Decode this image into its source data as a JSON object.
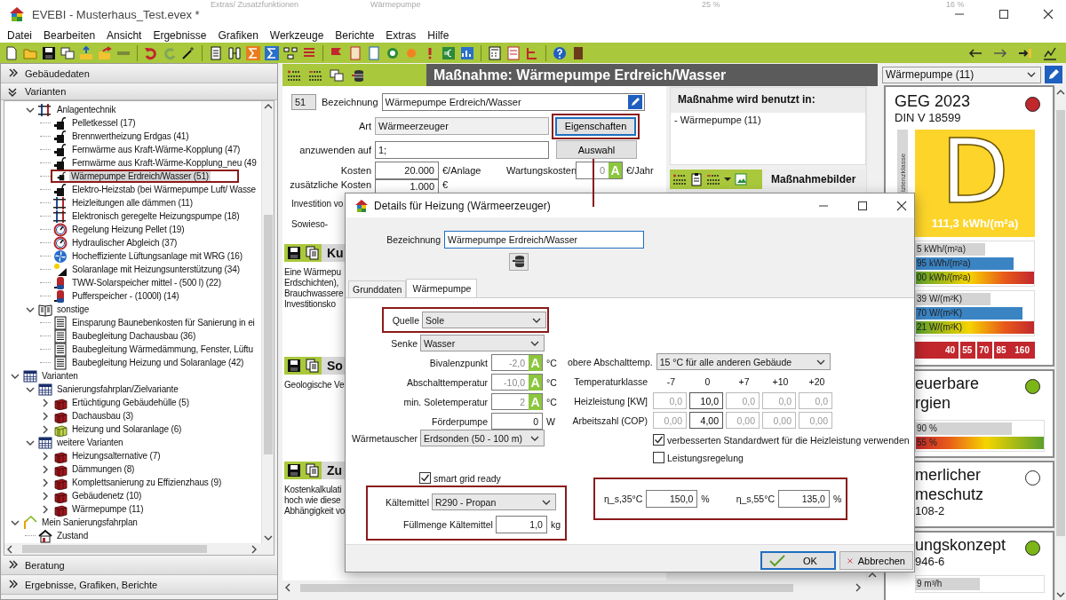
{
  "window": {
    "title": "EVEBI  - Musterhaus_Test.evex *",
    "background_texts": [
      "Extras/ Zusatzfunktionen",
      "Wärmepumpe",
      "25 %",
      "16 %"
    ]
  },
  "menu": [
    "Datei",
    "Bearbeiten",
    "Ansicht",
    "Ergebnisse",
    "Grafiken",
    "Werkzeuge",
    "Berichte",
    "Extras",
    "Hilfe"
  ],
  "left_panel": {
    "top_sections": [
      {
        "label": "Gebäudedaten",
        "expanded": false
      },
      {
        "label": "Varianten",
        "expanded": true
      }
    ],
    "tree": {
      "scrolled_group": [
        {
          "label": "Anlagentechnik",
          "kind": "pipes",
          "selected": false,
          "expanded": true,
          "children": [
            {
              "label": "Pelletkessel (17)",
              "kind": "heater",
              "selected": false
            },
            {
              "label": "Brennwertheizung Erdgas (41)",
              "kind": "heater",
              "selected": false
            },
            {
              "label": "Fernwärme aus Kraft-Wärme-Kopplung (47)",
              "kind": "heater",
              "selected": false
            },
            {
              "label": "Fernwärme aus Kraft-Wärme-Kopplung_neu (49",
              "kind": "heater",
              "selected": false
            },
            {
              "label": "Wärmepumpe Erdreich/Wasser (51)",
              "kind": "heater",
              "selected": true
            },
            {
              "label": "Elektro-Heizstab (bei Wärmepumpe Luft/ Wasse",
              "kind": "heater",
              "selected": false
            },
            {
              "label": "Heizleitungen alle dämmen (11)",
              "kind": "pipes",
              "selected": false
            },
            {
              "label": "Elektronisch geregelte Heizungspumpe (18)",
              "kind": "pipes",
              "selected": false
            },
            {
              "label": "Regelung Heizung Pellet (19)",
              "kind": "gauge",
              "selected": false
            },
            {
              "label": "Hydraulischer Abgleich (37)",
              "kind": "gauge",
              "selected": false
            },
            {
              "label": "Hocheffiziente Lüftungsanlage mit WRG (16)",
              "kind": "fan",
              "selected": false
            },
            {
              "label": "Solaranlage mit Heizungsunterstützung (34)",
              "kind": "solar",
              "selected": false
            },
            {
              "label": "TWW-Solarspeicher mittel - (500 l) (22)",
              "kind": "tank",
              "selected": false
            },
            {
              "label": "Pufferspeicher - (1000l) (14)",
              "kind": "tank",
              "selected": false
            }
          ]
        },
        {
          "label": "sonstige",
          "kind": "book",
          "selected": false,
          "expanded": true,
          "children": [
            {
              "label": "Einsparung Baunebenkosten für Sanierung in ei",
              "kind": "doc",
              "selected": false
            },
            {
              "label": "Baubegleitung Dachausbau (36)",
              "kind": "doc",
              "selected": false
            },
            {
              "label": "Baubegleitung Wärmedämmung, Fenster, Lüftu",
              "kind": "doc",
              "selected": false
            },
            {
              "label": "Baubegleitung Heizung und Solaranlage (42)",
              "kind": "doc",
              "selected": false
            }
          ]
        }
      ],
      "nodes": [
        {
          "label": "Varianten",
          "kind": "calendar",
          "selected": false,
          "expanded": true,
          "children": [
            {
              "label": "Sanierungsfahrplan/Zielvariante",
              "kind": "calendar",
              "selected": false,
              "expanded": true,
              "children": [
                {
                  "label": "Ertüchtigung Gebäudehülle (5)",
                  "kind": "gift",
                  "selected": false,
                  "expanded": false
                },
                {
                  "label": "Dachausbau (3)",
                  "kind": "gift",
                  "selected": false,
                  "expanded": false
                },
                {
                  "label": "Heizung und Solaranlage (6)",
                  "kind": "gift-green",
                  "selected": false,
                  "expanded": false
                }
              ]
            },
            {
              "label": "weitere Varianten",
              "kind": "calendar",
              "selected": false,
              "expanded": true,
              "children": [
                {
                  "label": "Heizungsalternative (7)",
                  "kind": "gift",
                  "selected": false,
                  "expanded": false
                },
                {
                  "label": "Dämmungen (8)",
                  "kind": "gift",
                  "selected": false,
                  "expanded": false
                },
                {
                  "label": "Komplettsanierung zu Effizienzhaus (9)",
                  "kind": "gift",
                  "selected": false,
                  "expanded": false
                },
                {
                  "label": "Gebäudenetz (10)",
                  "kind": "gift",
                  "selected": false,
                  "expanded": false
                },
                {
                  "label": "Wärmepumpe (11)",
                  "kind": "gift",
                  "selected": false,
                  "expanded": false
                }
              ]
            }
          ]
        },
        {
          "label": "Mein Sanierungsfahrplan",
          "kind": "plan",
          "selected": false,
          "expanded": true,
          "children": [
            {
              "label": "Zustand",
              "kind": "house",
              "selected": false
            }
          ]
        }
      ]
    },
    "bottom_sections": [
      {
        "label": "Beratung",
        "expanded": false
      },
      {
        "label": "Ergebnisse, Grafiken, Berichte",
        "expanded": false
      }
    ]
  },
  "measure": {
    "title": "Maßnahme: Wärmepumpe Erdreich/Wasser",
    "number": "51",
    "name": {
      "label": "Bezeichnung",
      "value": "Wärmepumpe Erdreich/Wasser"
    },
    "type": {
      "label": "Art",
      "value": "Wärmeerzeuger"
    },
    "properties_button": {
      "label": "Eigenschaften",
      "annotated": true
    },
    "apply_to": {
      "label": "anzuwenden auf",
      "value": "1;"
    },
    "select_button": {
      "label": "Auswahl"
    },
    "costs": {
      "label": "Kosten",
      "value": "20.000",
      "unit": "€/Anlage"
    },
    "maintenance": {
      "label": "Wartungskosten",
      "value": "0",
      "badge": "A",
      "unit": "€/Jahr"
    },
    "extra_costs": {
      "label": "zusätzliche Kosten",
      "value": "1.000",
      "unit": "€"
    },
    "cut_labels": [
      "Investition vo",
      "Sowieso-"
    ],
    "sections": [
      {
        "title": "Ku",
        "lines": [
          "Eine Wärmepu",
          "Erdschichten),",
          "Brauchwassere",
          "Investitionsko"
        ]
      },
      {
        "title": "So",
        "lines": [
          "Geologische Ve"
        ]
      },
      {
        "title": "Zu",
        "lines": [
          "Kostenkalkulati",
          "hoch wie diese",
          "Abhängigkeit vo"
        ]
      }
    ],
    "used_in": {
      "title": "Maßnahme wird benutzt in:",
      "items": [
        "- Wärmepumpe (11)"
      ]
    },
    "pictures_title": "Maßnahmebilder"
  },
  "dialog": {
    "title": "Details für Heizung  (Wärmeerzeuger)",
    "name": {
      "label": "Bezeichnung",
      "value": "Wärmepumpe Erdreich/Wasser"
    },
    "tabs": [
      {
        "label": "Grunddaten",
        "selected": false
      },
      {
        "label": "Wärmepumpe",
        "selected": true
      }
    ],
    "source": {
      "label": "Quelle",
      "value": "Sole",
      "annotated": true
    },
    "sink": {
      "label": "Senke",
      "value": "Wasser"
    },
    "temps": [
      {
        "label": "Bivalenzpunkt",
        "value": "-2,0",
        "badge": "A",
        "unit": "°C"
      },
      {
        "label": "Abschalttemperatur",
        "value": "-10,0",
        "badge": "A",
        "unit": "°C"
      },
      {
        "label": "min. Soletemperatur",
        "value": "2",
        "badge": "A",
        "unit": "°C"
      },
      {
        "label": "Förderpumpe",
        "value": "0",
        "unit": "W"
      }
    ],
    "heat_exchanger": {
      "label": "Wärmetauscher",
      "value": "Erdsonden (50 - 100 m)"
    },
    "upper_cutoff": {
      "label": "obere Abschalttemp.",
      "value": "15 °C für alle anderen Gebäude"
    },
    "temp_classes": {
      "label": "Temperaturklasse",
      "columns": [
        {
          "label": "-7",
          "selected": false
        },
        {
          "label": "0",
          "selected": true
        },
        {
          "label": "+7",
          "selected": false
        },
        {
          "label": "+10",
          "selected": false
        },
        {
          "label": "+20",
          "selected": false
        }
      ]
    },
    "performance_rows": [
      {
        "label": "Heizleistung [KW]",
        "values": [
          "0,0",
          "10,0",
          "0,0",
          "0,0",
          "0,0"
        ]
      },
      {
        "label": "Arbeitszahl (COP)",
        "values": [
          "0,00",
          "4,00",
          "0,00",
          "0,00",
          "0,00"
        ]
      }
    ],
    "checkboxes": [
      {
        "label": "verbesserten Standardwert für die Heizleistung verwenden",
        "checked": true
      },
      {
        "label": "Leistungsregelung",
        "checked": false
      }
    ],
    "smart_grid": {
      "label": "smart grid ready",
      "checked": true
    },
    "refrigerant": {
      "annotated": true,
      "type": {
        "label": "Kältemittel",
        "value": "R290 - Propan"
      },
      "amount": {
        "label": "Füllmenge Kältemittel",
        "value": "1,0",
        "unit": "kg"
      }
    },
    "efficiency": {
      "annotated": true,
      "items": [
        {
          "label": "η_s,35°C",
          "value": "150,0",
          "unit": "%"
        },
        {
          "label": "η_s,55°C",
          "value": "135,0",
          "unit": "%"
        }
      ]
    },
    "buttons": [
      {
        "label": "OK",
        "kind": "ok"
      },
      {
        "label": "Abbrechen",
        "kind": "cancel"
      }
    ]
  },
  "rating_panel": {
    "variant": "Wärmepumpe (11)",
    "cards": [
      {
        "kind": "geg",
        "title_lines": [
          "GEG 2023"
        ],
        "subtitle": "DIN V 18599",
        "color": "#c1272d",
        "side_label": "izienzklasse",
        "grade": "D",
        "grade_value": "111,3 kWh/(m²a)",
        "bar_groups": [
          [
            {
              "label": "5 kWh/(m²a)",
              "level": 0.59,
              "kind": "gray"
            },
            {
              "label": "95 kWh/(m²a)",
              "level": 0.83,
              "kind": "blue"
            },
            {
              "label": "00 kWh/(m²a)",
              "level": 1,
              "kind": "good-to-bad"
            }
          ],
          [
            {
              "label": "39 W/(m²K)",
              "level": 0.63,
              "kind": "gray"
            },
            {
              "label": "70 W/(m²K)",
              "level": 0.9,
              "kind": "blue"
            },
            {
              "label": "21 W/(m²K)",
              "level": 1,
              "kind": "good-to-bad"
            }
          ]
        ],
        "scale": [
          "40",
          "55",
          "70",
          "85",
          "160"
        ]
      },
      {
        "kind": "plain",
        "title_lines": [
          "euerbare",
          "rgien"
        ],
        "color": "#7cb518",
        "bar_groups": [
          [
            {
              "label": "90 %",
              "level": 0.75,
              "kind": "gray"
            },
            {
              "label": "55 %",
              "level": 1,
              "kind": "bad-to-good"
            }
          ]
        ]
      },
      {
        "kind": "plain",
        "title_lines": [
          "merlicher",
          "meschutz"
        ],
        "subtitle": "108-2",
        "color": "#ffffff"
      },
      {
        "kind": "plain",
        "title_lines": [
          "ungskonzept"
        ],
        "subtitle": "946-6",
        "color": "#7cb518",
        "bar_groups": [
          [
            {
              "label": "9 m³/h",
              "level": 0.5,
              "kind": "gray"
            }
          ]
        ]
      }
    ]
  }
}
